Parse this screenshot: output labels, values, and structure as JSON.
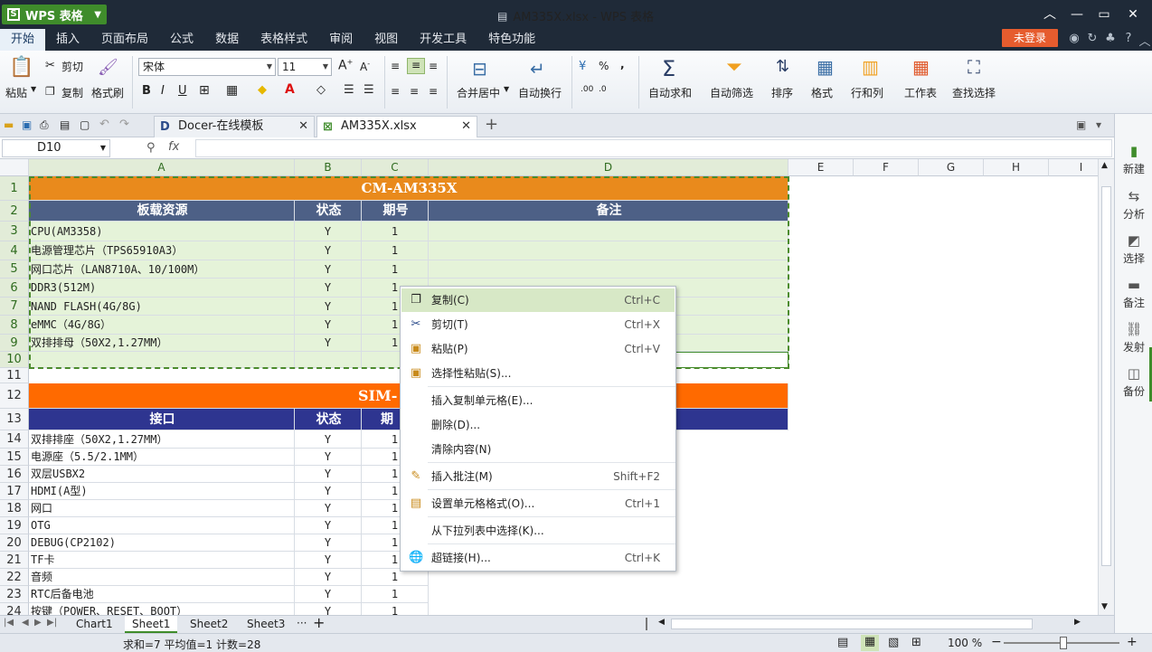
{
  "title": {
    "app_button": "WPS 表格",
    "window": "AM335X.xlsx - WPS 表格"
  },
  "menus": [
    "开始",
    "插入",
    "页面布局",
    "公式",
    "数据",
    "表格样式",
    "审阅",
    "视图",
    "开发工具",
    "特色功能"
  ],
  "login": "未登录",
  "ribbon": {
    "paste": "粘贴",
    "cut": "剪切",
    "copy": "复制",
    "format_painter": "格式刷",
    "font_name": "宋体",
    "font_size": "11",
    "merge_center": "合并居中",
    "wrap": "自动换行",
    "autosum": "自动求和",
    "autofilter": "自动筛选",
    "sort": "排序",
    "format": "格式",
    "rowcol": "行和列",
    "sheet": "工作表",
    "find": "查找选择",
    "percent": "%",
    "comma": ","
  },
  "tabs": [
    {
      "label": "Docer-在线模板"
    },
    {
      "label": "AM335X.xlsx"
    }
  ],
  "namebox": "D10",
  "columns": [
    "A",
    "B",
    "C",
    "D",
    "E",
    "F",
    "G",
    "H",
    "I"
  ],
  "rows": [
    "1",
    "2",
    "3",
    "4",
    "5",
    "6",
    "7",
    "8",
    "9",
    "10",
    "11",
    "12",
    "13",
    "14",
    "15",
    "16",
    "17",
    "18",
    "19",
    "20",
    "21",
    "22",
    "23",
    "24"
  ],
  "table1": {
    "title": "CM-AM335X",
    "headers": [
      "板载资源",
      "状态",
      "期号",
      "备注"
    ],
    "rows": [
      [
        "CPU(AM3358)",
        "Y",
        "1"
      ],
      [
        "电源管理芯片（TPS65910A3）",
        "Y",
        "1"
      ],
      [
        "网口芯片（LAN8710A、10/100M）",
        "Y",
        "1"
      ],
      [
        "DDR3(512M)",
        "Y",
        "1"
      ],
      [
        "NAND FLASH(4G/8G)",
        "Y",
        "1"
      ],
      [
        "eMMC（4G/8G）",
        "Y",
        "1"
      ],
      [
        "双排排母（50X2,1.27MM）",
        "Y",
        "1"
      ]
    ]
  },
  "table2": {
    "title": "SIM-",
    "headers": [
      "接口",
      "状态",
      "期号"
    ],
    "header3_visible": "期",
    "rows": [
      [
        "双排排座（50X2,1.27MM）",
        "Y",
        "1"
      ],
      [
        "电源座（5.5/2.1MM）",
        "Y",
        "1"
      ],
      [
        "双层USBX2",
        "Y",
        "1"
      ],
      [
        "HDMI(A型)",
        "Y",
        "1"
      ],
      [
        "网口",
        "Y",
        "1"
      ],
      [
        "OTG",
        "Y",
        "1"
      ],
      [
        "DEBUG(CP2102)",
        "Y",
        "1"
      ],
      [
        "TF卡",
        "Y",
        "1"
      ],
      [
        "音频",
        "Y",
        "1"
      ],
      [
        "RTC后备电池",
        "Y",
        "1"
      ],
      [
        "按键（POWER、RESET、BOOT）",
        "Y",
        "1"
      ]
    ]
  },
  "context_menu": [
    {
      "label": "复制(C)",
      "shortcut": "Ctrl+C",
      "icon": "copy-icon"
    },
    {
      "label": "剪切(T)",
      "shortcut": "Ctrl+X",
      "icon": "scissors-icon"
    },
    {
      "label": "粘贴(P)",
      "shortcut": "Ctrl+V",
      "icon": "paste-icon"
    },
    {
      "label": "选择性粘贴(S)...",
      "shortcut": "",
      "icon": "paste-special-icon"
    },
    {
      "label": "插入复制单元格(E)...",
      "shortcut": ""
    },
    {
      "label": "删除(D)...",
      "shortcut": ""
    },
    {
      "label": "清除内容(N)",
      "shortcut": ""
    },
    {
      "label": "插入批注(M)",
      "shortcut": "Shift+F2",
      "icon": "comment-icon"
    },
    {
      "label": "设置单元格格式(O)...",
      "shortcut": "Ctrl+1",
      "icon": "format-cells-icon"
    },
    {
      "label": "从下拉列表中选择(K)...",
      "shortcut": ""
    },
    {
      "label": "超链接(H)...",
      "shortcut": "Ctrl+K",
      "icon": "hyperlink-icon"
    }
  ],
  "sheets": [
    "Chart1",
    "Sheet1",
    "Sheet2",
    "Sheet3"
  ],
  "sheet_more": "···",
  "status": {
    "summary": "求和=7  平均值=1  计数=28",
    "zoom": "100 %"
  },
  "right_panel": [
    "新建",
    "分析",
    "选择",
    "备注",
    "发射",
    "备份"
  ],
  "colors": {
    "orange": "#e98a1c",
    "steel": "#4d6086",
    "orange2": "#ff6a00",
    "navy": "#2e3590",
    "selection": "#e5f3d9",
    "app_green": "#3f8c2b"
  }
}
